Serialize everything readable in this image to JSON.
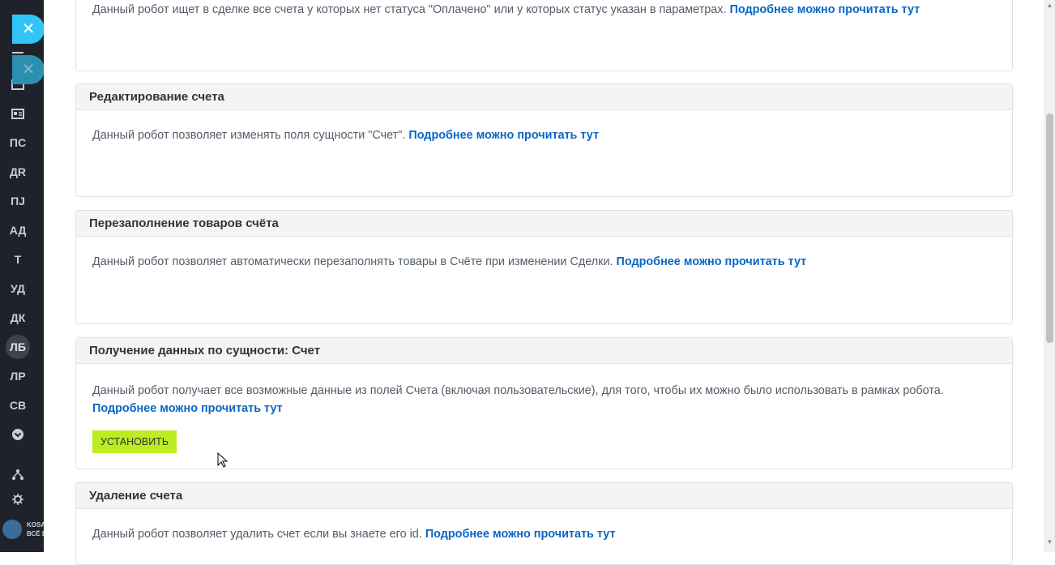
{
  "sidebar": {
    "items": [
      {
        "label": "ПС"
      },
      {
        "label": "ДR"
      },
      {
        "label": "ПJ"
      },
      {
        "label": "АД"
      },
      {
        "label": "Т"
      },
      {
        "label": "УД"
      },
      {
        "label": "ДК"
      },
      {
        "label": "ЛБ"
      },
      {
        "label": "ЛР"
      },
      {
        "label": "СВ"
      }
    ],
    "brand_line1": "KOSA",
    "brand_line2": "ВСЁ Е"
  },
  "cards": [
    {
      "title": "",
      "description": "Данный робот ищет в сделке все счета у которых нет статуса \"Оплачено\" или у которых статус указан в параметрах.",
      "link": "Подробнее можно прочитать тут"
    },
    {
      "title": "Редактирование счета",
      "description": "Данный робот позволяет изменять поля сущности \"Счет\".",
      "link": "Подробнее можно прочитать тут"
    },
    {
      "title": "Перезаполнение товаров счёта",
      "description": "Данный робот позволяет автоматически перезаполнять товары в Счёте при изменении Сделки.",
      "link": "Подробнее можно прочитать тут"
    },
    {
      "title": "Получение данных по сущности: Счет",
      "description": "Данный робот получает все возможные данные из полей Счета (включая пользовательские), для того, чтобы их можно было использовать в рамках робота.",
      "link": "Подробнее можно прочитать тут",
      "button": "УСТАНОВИТЬ"
    },
    {
      "title": "Удаление счета",
      "description": "Данный робот позволяет удалить счет если вы знаете его id.",
      "link": "Подробнее можно прочитать тут"
    }
  ],
  "colors": {
    "rail": "#1e232b",
    "accent_close": "#2fc6f6",
    "link": "#0b66c3",
    "install_button": "#bbed21"
  },
  "icons": [
    "close-icon",
    "filter-icon",
    "folder-icon",
    "contact-card-icon",
    "chevron-down-circle-icon",
    "hierarchy-icon",
    "gear-icon"
  ]
}
